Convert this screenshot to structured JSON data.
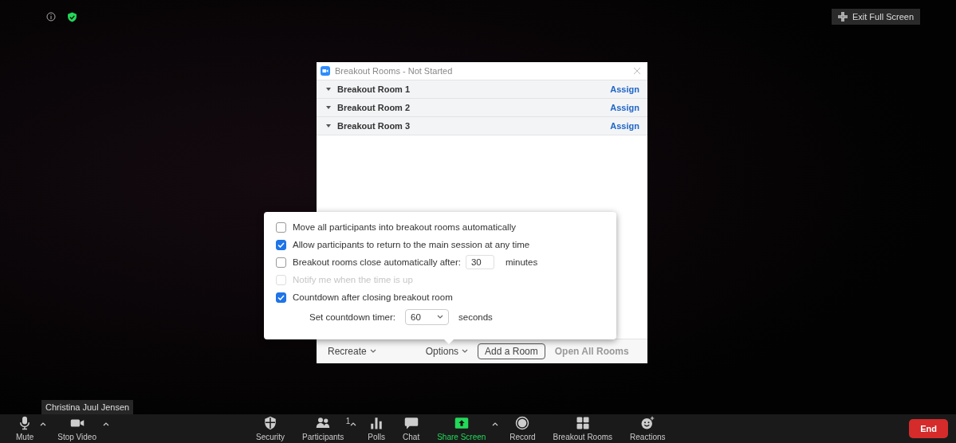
{
  "top_bar": {
    "exit_button": "Exit Full Screen"
  },
  "dialog": {
    "title": "Breakout Rooms - Not Started",
    "rooms": [
      {
        "name": "Breakout Room 1",
        "action": "Assign"
      },
      {
        "name": "Breakout Room 2",
        "action": "Assign"
      },
      {
        "name": "Breakout Room 3",
        "action": "Assign"
      }
    ],
    "footer": {
      "recreate": "Recreate",
      "options": "Options",
      "add": "Add a Room",
      "open_all": "Open All Rooms"
    }
  },
  "options_menu": [
    {
      "kind": "checkbox",
      "label": "Move all participants into breakout rooms automatically",
      "checked": false,
      "disabled": false
    },
    {
      "kind": "checkbox",
      "label": "Allow participants to return to the main session at any time",
      "checked": true,
      "disabled": false
    },
    {
      "kind": "checkbox",
      "label": "Breakout rooms close automatically after:",
      "checked": false,
      "disabled": false,
      "value": "30",
      "unit": "minutes"
    },
    {
      "kind": "checkbox",
      "label": "Notify me when the time is up",
      "checked": false,
      "disabled": true
    },
    {
      "kind": "checkbox",
      "label": "Countdown after closing breakout room",
      "checked": true,
      "disabled": false
    },
    {
      "kind": "select",
      "label": "Set countdown timer:",
      "value": "60",
      "unit": "seconds"
    }
  ],
  "name_tag": "Christina Juul Jensen",
  "toolbar": [
    {
      "kind": "mic",
      "label": "Mute",
      "menu": true,
      "active": false
    },
    {
      "kind": "video",
      "label": "Stop Video",
      "menu": true,
      "active": false
    },
    {
      "kind": "spacer"
    },
    {
      "kind": "shield",
      "label": "Security",
      "active": false
    },
    {
      "kind": "people",
      "label": "Participants",
      "count": "1",
      "menu": true,
      "active": false
    },
    {
      "kind": "polls",
      "label": "Polls",
      "active": false
    },
    {
      "kind": "chat",
      "label": "Chat",
      "active": false
    },
    {
      "kind": "share",
      "label": "Share Screen",
      "menu": true,
      "active": true
    },
    {
      "kind": "record",
      "label": "Record",
      "active": false
    },
    {
      "kind": "rooms",
      "label": "Breakout Rooms",
      "active": false
    },
    {
      "kind": "reactions",
      "label": "Reactions",
      "active": false
    }
  ],
  "end_button": "End"
}
